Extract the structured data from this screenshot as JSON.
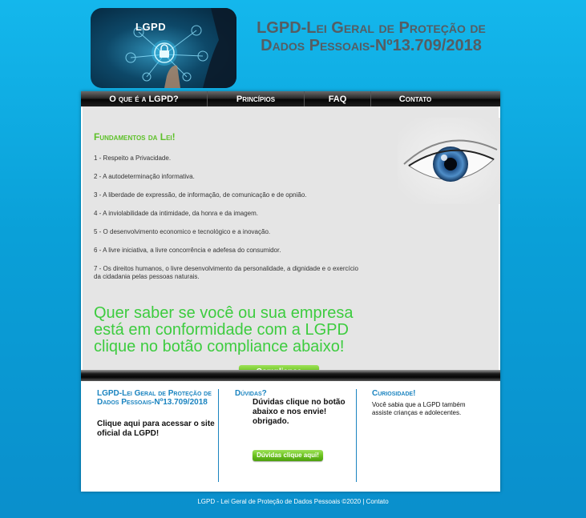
{
  "header": {
    "logo_text": "LGPD",
    "title_line1": "LGPD-Lei Geral de Proteção de",
    "title_line2": "Dados Pessoais-Nº13.709/2018"
  },
  "nav": {
    "items": [
      {
        "label": "O que é a LGPD?"
      },
      {
        "label": "Princípios"
      },
      {
        "label": "FAQ"
      },
      {
        "label": "Contato"
      }
    ]
  },
  "main": {
    "section_title": "Fundamentos da Lei!",
    "principles": [
      "1 - Respeito a Privacidade.",
      "2 - A autodeterminação informativa.",
      "3 - A liberdade de expressão, de informação, de comunicação e de opnião.",
      "4 - A inviolabilidade da intimidade, da honra e da imagem.",
      "5 - O desenvolvimento economico e tecnológico e a inovação.",
      "6 - A livre iniciativa, a livre concorrência e adefesa do consumidor.",
      "7 - Os direitos humanos, o livre desenvolvimento da personalidade, a dignidade e o exercício da cidadania pelas pessoas naturais."
    ],
    "cta_text": "Quer saber se você ou sua empresa está em conformidade com a LGPD clique no botão compliance abaixo!",
    "compliance_button": "Compliance"
  },
  "columns": {
    "col1": {
      "title": "LGPD-Lei Geral de Proteção de Dados Pessoais-Nº13.709/2018",
      "text": "Clique aqui para acessar o site oficial da LGPD!"
    },
    "col2": {
      "title": "Dúvidas?",
      "text": "Dúvidas clique no botão abaixo e nos envie! obrigado.",
      "button": "Dúvidas clique aqui!"
    },
    "col3": {
      "title": "Curiosidade!",
      "text": "Você sabia que a LGPD também assiste crianças e adolecentes."
    }
  },
  "footer": {
    "text": "LGPD - Lei Geral de Proteção de Dados Pessoais ©2020 | Contato"
  },
  "colors": {
    "accent_green": "#3dcc3f",
    "title_green": "#5ec12a",
    "accent_blue": "#1b84c0",
    "bg_blue": "#0aa0d8"
  }
}
